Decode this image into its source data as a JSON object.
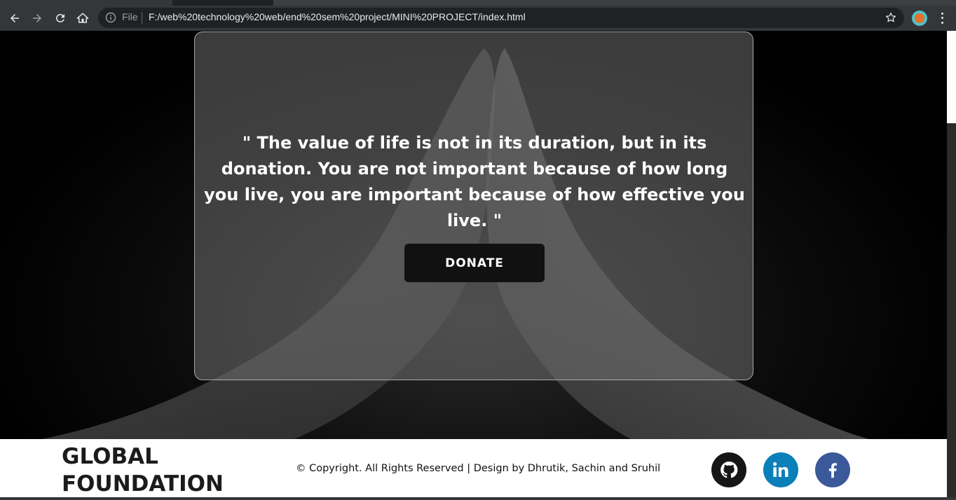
{
  "browser": {
    "file_label": "File",
    "url": "F:/web%20technology%20web/end%20sem%20project/MINI%20PROJECT/index.html",
    "icons": [
      "back-icon",
      "forward-icon",
      "reload-icon",
      "home-icon",
      "info-icon",
      "star-icon",
      "profile-avatar",
      "menu-icon"
    ]
  },
  "hero": {
    "quote": "\" The value of life is not in its duration, but in its donation. You are not important because of how long you live, you are important because of how effective you live. \"",
    "donate_label": "DONATE"
  },
  "footer": {
    "brand_line1": "GLOBAL",
    "brand_line2": "FOUNDATION",
    "copyright": "© Copyright. All Rights Reserved | Design by Dhrutik, Sachin and Sruhil",
    "social": [
      {
        "name": "github",
        "color": "#161616"
      },
      {
        "name": "linkedin",
        "color": "#0a7fb8"
      },
      {
        "name": "facebook",
        "color": "#3b5998"
      }
    ]
  }
}
